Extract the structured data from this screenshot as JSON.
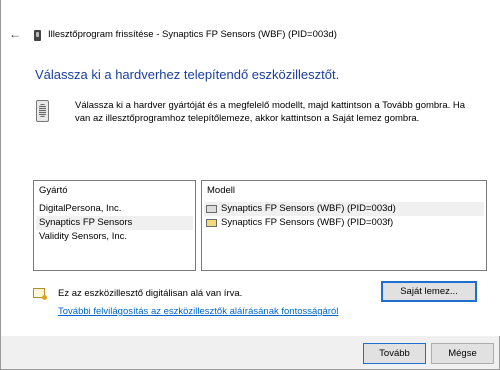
{
  "window": {
    "title": "Illesztőprogram frissítése - Synaptics FP Sensors (WBF) (PID=003d)"
  },
  "heading": "Válassza ki a hardverhez telepítendő eszközillesztőt.",
  "instructions": "Válassza ki a hardver gyártóját és a megfelelő modellt, majd kattintson a Tovább gombra. Ha van az illesztőprogramhoz telepítőlemeze, akkor kattintson a Saját lemez gombra.",
  "manufacturer_list": {
    "header": "Gyártó",
    "items": [
      "DigitalPersona, Inc.",
      "Synaptics FP Sensors",
      "Validity Sensors, Inc."
    ],
    "selected_index": 1
  },
  "model_list": {
    "header": "Modell",
    "items": [
      "Synaptics FP Sensors (WBF) (PID=003d)",
      "Synaptics FP Sensors (WBF) (PID=003f)"
    ],
    "selected_index": 0
  },
  "signature": {
    "status_text": "Ez az eszközillesztő digitálisan alá van írva.",
    "link_text": "További felvilágosítás az eszközillesztők aláírásának fontosságáról"
  },
  "buttons": {
    "have_disk": "Saját lemez...",
    "next": "Tovább",
    "cancel": "Mégse"
  },
  "icons": {
    "back": "back-arrow-icon",
    "device": "fingerprint-device-icon",
    "info": "fingerprint-reader-icon",
    "certificate": "certificate-icon"
  }
}
